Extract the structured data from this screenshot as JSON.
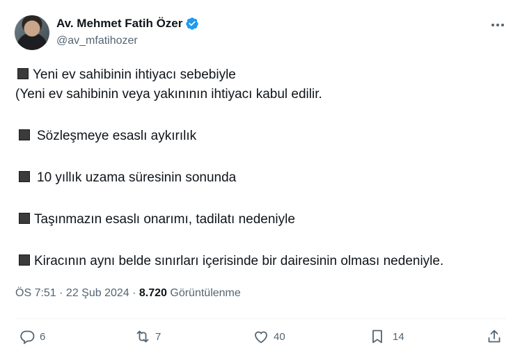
{
  "author": {
    "name": "Av. Mehmet Fatih Özer",
    "handle": "@av_mfatihozer",
    "verified_color": "#1d9bf0"
  },
  "tweet": {
    "lines": [
      "Yeni ev sahibinin ihtiyacı sebebiyle",
      "(Yeni ev sahibinin veya yakınının ihtiyacı kabul edilir.",
      "Sözleşmeye esaslı aykırılık",
      "10 yıllık uzama süresinin sonunda",
      "Taşınmazın esaslı onarımı, tadilatı nedeniyle",
      "Kiracının aynı belde sınırları içerisinde bir dairesinin olması nedeniyle."
    ]
  },
  "meta": {
    "time": "ÖS 7:51",
    "sep1": " · ",
    "date": "22 Şub 2024",
    "sep2": " · ",
    "views": "8.720",
    "views_label": " Görüntülenme"
  },
  "actions": {
    "replies": "6",
    "reposts": "7",
    "likes": "40",
    "bookmarks": "14"
  }
}
